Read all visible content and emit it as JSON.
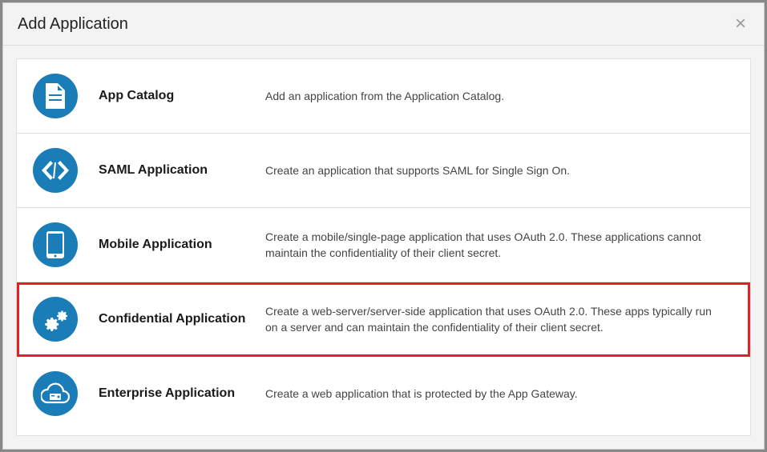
{
  "modal": {
    "title": "Add Application",
    "close_label": "×"
  },
  "options": [
    {
      "icon": "document-icon",
      "title": "App Catalog",
      "description": "Add an application from the Application Catalog.",
      "highlighted": false
    },
    {
      "icon": "code-icon",
      "title": "SAML Application",
      "description": "Create an application that supports SAML for Single Sign On.",
      "highlighted": false
    },
    {
      "icon": "mobile-icon",
      "title": "Mobile Application",
      "description": "Create a mobile/single-page application that uses OAuth 2.0. These applications cannot maintain the confidentiality of their client secret.",
      "highlighted": false
    },
    {
      "icon": "gears-icon",
      "title": "Confidential Application",
      "description": "Create a web-server/server-side application that uses OAuth 2.0. These apps typically run on a server and can maintain the confidentiality of their client secret.",
      "highlighted": true
    },
    {
      "icon": "cloud-icon",
      "title": "Enterprise Application",
      "description": "Create a web application that is protected by the App Gateway.",
      "highlighted": false
    }
  ]
}
